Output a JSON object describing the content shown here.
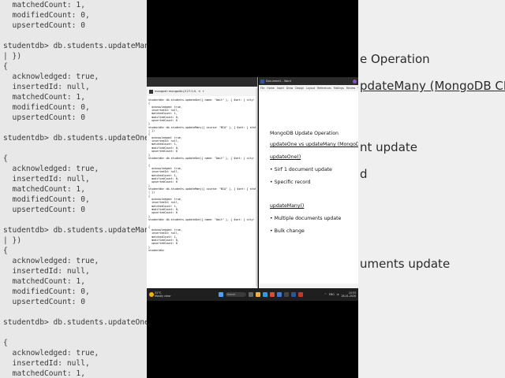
{
  "bg_left_lines": [
    "  matchedCount: 1,",
    "  modifiedCount: 0,",
    "  upsertedCount: 0",
    "",
    "studentdb> db.students.updateMany({ course: \"",
    "| })",
    "{",
    "  acknowledged: true,",
    "  insertedId: null,",
    "  matchedCount: 1,",
    "  modifiedCount: 0,",
    "  upsertedCount: 0",
    "",
    "studentdb> db.students.updateOne({ name: \"Aei",
    "",
    "{",
    "  acknowledged: true,",
    "  insertedId: null,",
    "  matchedCount: 1,",
    "  modifiedCount: 0,",
    "  upsertedCount: 0",
    "",
    "studentdb> db.students.updateMany({ course: \"",
    "| })",
    "{",
    "  acknowledged: true,",
    "  insertedId: null,",
    "  matchedCount: 1,",
    "  modifiedCount: 0,",
    "  upsertedCount: 0",
    "",
    "studentdb> db.students.updateOne({ name: \"Aei",
    "",
    "{",
    "  acknowledged: true,",
    "  insertedId: null,",
    "  matchedCount: 1,"
  ],
  "bg_right_lines": [
    {
      "text": "e Operation",
      "underline": false
    },
    {
      "text": "pdateMany (MongoDB CMD)",
      "underline": true
    },
    {
      "text": "nt update",
      "underline": false
    },
    {
      "text": "d",
      "underline": false
    },
    {
      "text": "uments update",
      "underline": false
    }
  ],
  "terminal": {
    "tab_label": "mongosh mongodb://127.0.0.",
    "lines": [
      "studentdb> db.students.updateOne({ name: \"Amit\" }, { $set: { city: \"Mumbai\" } })",
      "{",
      "  acknowledged: true,",
      "  insertedId: null,",
      "  matchedCount: 1,",
      "  modifiedCount: 0,",
      "  upsertedCount: 0",
      "}",
      "studentdb> db.students.updateMany({ course: \"BCA\" }, { $set: { status: \"Active\" } })",
      "| })",
      "{",
      "  acknowledged: true,",
      "  insertedId: null,",
      "  matchedCount: 1,",
      "  modifiedCount: 0,",
      "  upsertedCount: 0",
      "}",
      "studentdb> db.students.updateOne({ name: \"Amit\" }, { $set: { city: \"Mumbai\" } })",
      "",
      "{",
      "  acknowledged: true,",
      "  insertedId: null,",
      "  matchedCount: 1,",
      "  modifiedCount: 0,",
      "  upsertedCount: 0",
      "}",
      "studentdb> db.students.updateMany({ course: \"BCA\" }, { $set: { status: \"Active\" } })",
      "| })",
      "{",
      "  acknowledged: true,",
      "  insertedId: null,",
      "  matchedCount: 1,",
      "  modifiedCount: 0,",
      "  upsertedCount: 0",
      "}",
      "studentdb> db.students.updateOne({ name: \"Amit\" }, { $set: { city: \"Mumbai\" } })",
      "",
      "{",
      "  acknowledged: true,",
      "  insertedId: null,",
      "  matchedCount: 1,",
      "  modifiedCount: 0,",
      "  upsertedCount: 0",
      "}",
      "studentdb> "
    ]
  },
  "word": {
    "title": "Document1 - Word",
    "ribbon_tabs": [
      "File",
      "Home",
      "Insert",
      "Draw",
      "Design",
      "Layout",
      "References",
      "Mailings",
      "Review",
      "View",
      "Help"
    ],
    "lines": [
      {
        "text": "MongoDB Update Operation",
        "underline": false
      },
      {
        "text": "updateOne vs updateMany (MongoDB CMD)",
        "underline": true
      },
      {
        "text": "updateOne()",
        "underline": true
      },
      {
        "text": "• Sirf 1 document update",
        "underline": false
      },
      {
        "text": "• Specific record",
        "underline": false
      },
      {
        "text": "updateMany()",
        "underline": true
      },
      {
        "text": "• Multiple documents update",
        "underline": false
      },
      {
        "text": "• Bulk change",
        "underline": false
      }
    ]
  },
  "taskbar": {
    "weather_temp": "31°C",
    "weather_desc": "Mostly clear",
    "search_placeholder": "Search",
    "language": "ENG",
    "time": "10:53",
    "date": "28-01-2026"
  },
  "colors": {
    "taskbar_bg": "#1f1f1f",
    "terminal_bg": "#ffffff",
    "word_titlebar": "#2b2b2b",
    "weather_sun": "#f6b10b"
  }
}
